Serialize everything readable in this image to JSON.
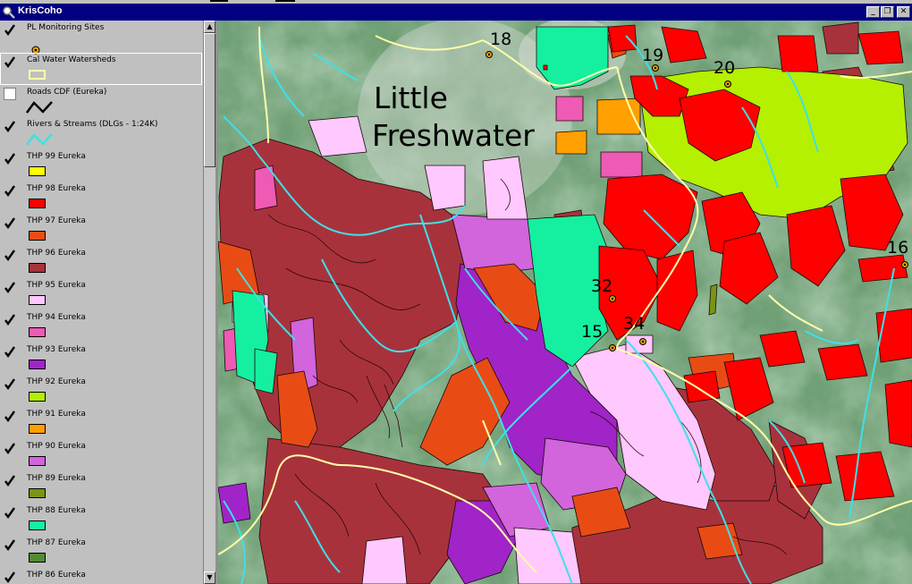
{
  "window": {
    "title": "KrisCoho",
    "minimize_glyph": "_",
    "restore_glyph": "❐",
    "close_glyph": "✕"
  },
  "colors": {
    "titlebar": "#000080",
    "panel": "#c0c0c0",
    "check": "#000000"
  },
  "legend": {
    "entries": [
      {
        "label": "PL Monitoring Sites",
        "checked": true,
        "symbol": "site-dot-icon"
      },
      {
        "label": "Cal Water Watersheds",
        "checked": true,
        "symbol": "watershed-outline",
        "color": "#ffffa8"
      },
      {
        "label": "Roads CDF (Eureka)",
        "checked": false,
        "symbol": "road-line-icon",
        "color": "#000000"
      },
      {
        "label": "Rivers & Streams (DLGs - 1:24K)",
        "checked": true,
        "symbol": "stream-line-icon",
        "color": "#3ee0e8"
      },
      {
        "label": "THP 99 Eureka",
        "checked": true,
        "color": "#ffff00"
      },
      {
        "label": "THP 98 Eureka",
        "checked": true,
        "color": "#ff0000"
      },
      {
        "label": "THP 97 Eureka",
        "checked": true,
        "color": "#e84c14"
      },
      {
        "label": "THP 96 Eureka",
        "checked": true,
        "color": "#a8323c"
      },
      {
        "label": "THP 95 Eureka",
        "checked": true,
        "color": "#ffc8ff"
      },
      {
        "label": "THP 94 Eureka",
        "checked": true,
        "color": "#ee5ab4"
      },
      {
        "label": "THP 93 Eureka",
        "checked": true,
        "color": "#a024c8"
      },
      {
        "label": "THP 92 Eureka",
        "checked": true,
        "color": "#b4f000"
      },
      {
        "label": "THP 91 Eureka",
        "checked": true,
        "color": "#ffa000"
      },
      {
        "label": "THP 90 Eureka",
        "checked": true,
        "color": "#d264dc"
      },
      {
        "label": "THP 89 Eureka",
        "checked": true,
        "color": "#789614"
      },
      {
        "label": "THP 88 Eureka",
        "checked": true,
        "color": "#14f0a0"
      },
      {
        "label": "THP 87 Eureka",
        "checked": true,
        "color": "#508c32"
      },
      {
        "label": "THP 86 Eureka",
        "checked": true,
        "color": "#00a0a0"
      }
    ]
  },
  "map": {
    "place_label_line1": "Little",
    "place_label_line2": "Freshwater",
    "sites": [
      {
        "label": "18"
      },
      {
        "label": "19"
      },
      {
        "label": "20"
      },
      {
        "label": "16"
      },
      {
        "label": "32"
      },
      {
        "label": "15"
      },
      {
        "label": "34"
      }
    ]
  }
}
